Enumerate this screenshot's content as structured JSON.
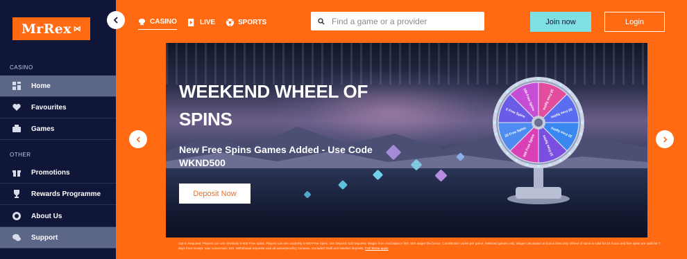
{
  "brand": {
    "logo_text": "MrRex"
  },
  "sidebar": {
    "casino_label": "CASINO",
    "other_label": "OTHER",
    "items": [
      {
        "label": "Home",
        "icon": "dashboard-icon",
        "active": true
      },
      {
        "label": "Favourites",
        "icon": "heart-icon"
      },
      {
        "label": "Games",
        "icon": "games-icon"
      },
      {
        "label": "Promotions",
        "icon": "gift-icon"
      },
      {
        "label": "Rewards Programme",
        "icon": "trophy-icon"
      },
      {
        "label": "About Us",
        "icon": "info-icon"
      },
      {
        "label": "Support",
        "icon": "chat-icon",
        "active": true
      }
    ]
  },
  "topnav": {
    "casino": "CASINO",
    "live": "LIVE",
    "sports": "SPORTS"
  },
  "search": {
    "placeholder": "Find a game or a provider"
  },
  "auth": {
    "join": "Join now",
    "login": "Login"
  },
  "banner": {
    "title": "WEEKEND WHEEL OF SPINS",
    "subtitle": "New Free Spins Games Added - Use Code WKND500",
    "cta": "Deposit Now",
    "wheel_segments": [
      "10 Free Spins",
      "50 Free Spins",
      "20 Free Spins",
      "10 Free Spins",
      "500 Free Spins",
      "20 Free Spins",
      "5 Free Spins",
      "100 Free Spins"
    ]
  },
  "terms": {
    "text": "Opt-in Required. Players can win randomly 5-500 Free Spins. Players can win randomly 5-500 Free Spins. Min Deposit: £20 required. Wager from real balance first. 50X wager the bonus. Contribution varies per game. Selected games only. Wager calculated on bonus bets only. Wheel of spins is valid for 24 hours and free spins are valid for 7 days from receipt. Max conversion: £20. Withdrawal requests void all active/pending bonuses. Excluded Skrill and Neteller deposits.",
    "link": "Full Terms apply"
  },
  "colors": {
    "accent": "#ff6a13",
    "sidebar": "#0f1637",
    "join": "#7ee0e3"
  }
}
